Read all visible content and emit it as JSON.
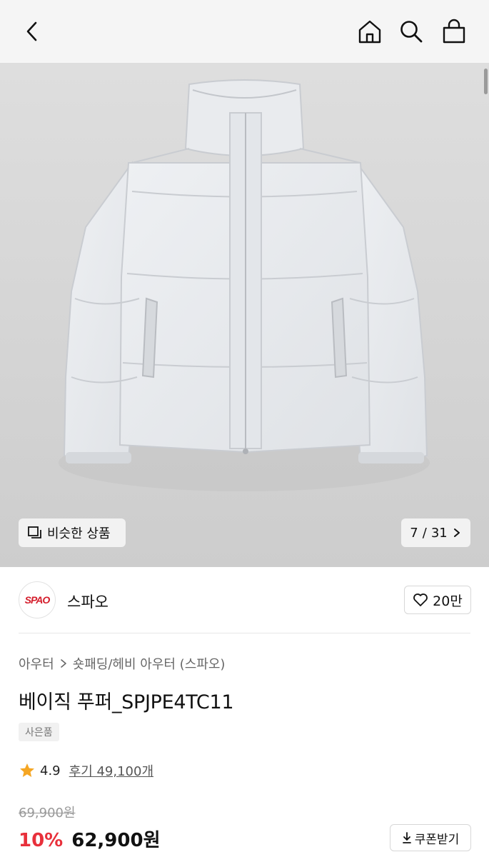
{
  "header": {
    "icons": [
      "back-icon",
      "home-icon",
      "search-icon",
      "shopping-bag-icon"
    ]
  },
  "gallery": {
    "similar_label": "비슷한 상품",
    "current": "7",
    "separator": "/",
    "total": "31",
    "image_description": "light grey puffer jacket"
  },
  "brand": {
    "logo_text": "SPAO",
    "name": "스파오",
    "likes": "20만"
  },
  "breadcrumb": {
    "category": "아우터",
    "subcategory": "숏패딩/헤비 아우터 (스파오)"
  },
  "product": {
    "title": "베이직 푸퍼_SPJPE4TC11",
    "tag": "사은품"
  },
  "rating": {
    "score": "4.9",
    "reviews": "후기 49,100개"
  },
  "pricing": {
    "original": "69,900원",
    "discount": "10%",
    "price": "62,900원",
    "coupon_label": "쿠폰받기"
  },
  "colors": {
    "discount": "#e8303b",
    "star": "#f5a623",
    "brand_red": "#d41c2a"
  }
}
